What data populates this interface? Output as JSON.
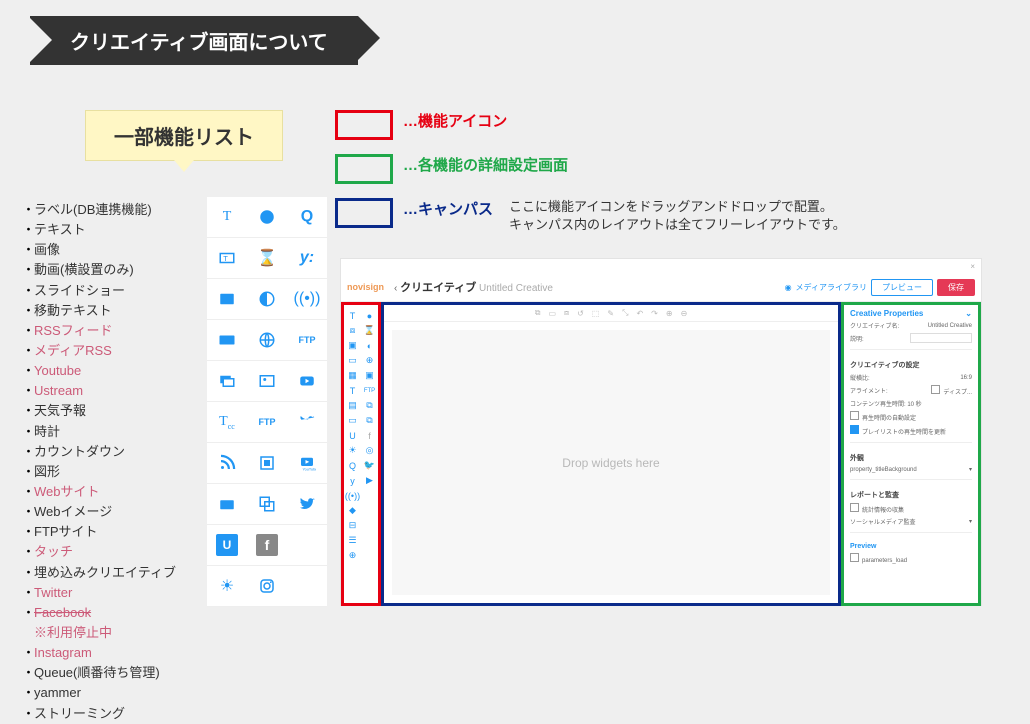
{
  "title": "クリエイティブ画面について",
  "callout": "一部機能リスト",
  "features": [
    {
      "label": "ラベル(DB連携機能)",
      "pink": false
    },
    {
      "label": "テキスト",
      "pink": false
    },
    {
      "label": "画像",
      "pink": false
    },
    {
      "label": "動画(横設置のみ)",
      "pink": false
    },
    {
      "label": "スライドショー",
      "pink": false
    },
    {
      "label": "移動テキスト",
      "pink": false
    },
    {
      "label": "RSSフィード",
      "pink": true
    },
    {
      "label": "メディアRSS",
      "pink": true
    },
    {
      "label": "Youtube",
      "pink": true
    },
    {
      "label": "Ustream",
      "pink": true
    },
    {
      "label": "天気予報",
      "pink": false
    },
    {
      "label": "時計",
      "pink": false
    },
    {
      "label": "カウントダウン",
      "pink": false
    },
    {
      "label": "図形",
      "pink": false
    },
    {
      "label": "Webサイト",
      "pink": true
    },
    {
      "label": "Webイメージ",
      "pink": false
    },
    {
      "label": "FTPサイト",
      "pink": false
    },
    {
      "label": "タッチ",
      "pink": true
    },
    {
      "label": "埋め込みクリエイティブ",
      "pink": false
    },
    {
      "label": "Twitter",
      "pink": true
    },
    {
      "label": "Facebook",
      "pink": true,
      "strike": true
    },
    {
      "label": "※利用停止中",
      "pink": true,
      "sub": true
    },
    {
      "label": "Instagram",
      "pink": true
    },
    {
      "label": "Queue(順番待ち管理)",
      "pink": false
    },
    {
      "label": "yammer",
      "pink": false
    },
    {
      "label": "ストリーミング",
      "pink": false
    }
  ],
  "legend": {
    "red": "…機能アイコン",
    "green": "…各機能の詳細設定画面",
    "blue": "…キャンパス",
    "blue_side1": "ここに機能アイコンをドラッグアンドドロップで配置。",
    "blue_side2": "キャンパス内のレイアウトは全てフリーレイアウトです。"
  },
  "palette_labels": {
    "T": "T",
    "clock": "●",
    "Q": "Q",
    "txt": "⧈",
    "hour": "⌛",
    "y": "y:",
    "img": "▣",
    "shape": "◐",
    "wifi": "((•))",
    "film": "⛶",
    "globe": "⊕",
    "ftp": "FTP",
    "ticket": "▦",
    "cam": "⛶",
    "yt": "▶",
    "Tcc": "T",
    "ftp2": "FTP",
    "tw": "𝕏",
    "rss": "▤",
    "embed": "⧉",
    "yt2": "▶",
    "tw2": "🐦",
    "U": "U",
    "fb": "f",
    "sun": "☀",
    "ig": "◎"
  },
  "editor": {
    "close": "×",
    "logo": "novisign",
    "crumb_back": "‹",
    "crumb_title": "クリエイティブ",
    "crumb_name": "Untitled Creative",
    "media_link": "メディアライブラリ",
    "btn_preview": "プレビュー",
    "btn_save": "保存",
    "canvas_drop": "Drop widgets here",
    "camera": "◉",
    "props": {
      "title": "Creative Properties",
      "chev": "⌄",
      "name_lbl": "クリエイティブ名:",
      "name_val": "Untitled Creative",
      "desc_lbl": "説明:",
      "sec_settings": "クリエイティブの設定",
      "aspect_lbl": "縦横比:",
      "aspect_val": "16:9",
      "align_lbl": "アライメント:",
      "align_disp": "ディスプ...",
      "content_lbl": "コンテンツ再生時間: 10 秒",
      "cb1": "再生時間の自動設定",
      "cb2": "プレイリストの再生時間を更新",
      "sec_ext": "外観",
      "bg_lbl": "property_titleBackground",
      "sec_report": "レポートと監査",
      "cb3": "統計情報の収集",
      "social_lbl": "ソーシャルメディア監査",
      "sec_preview": "Preview",
      "cb4": "parameters_load"
    }
  }
}
